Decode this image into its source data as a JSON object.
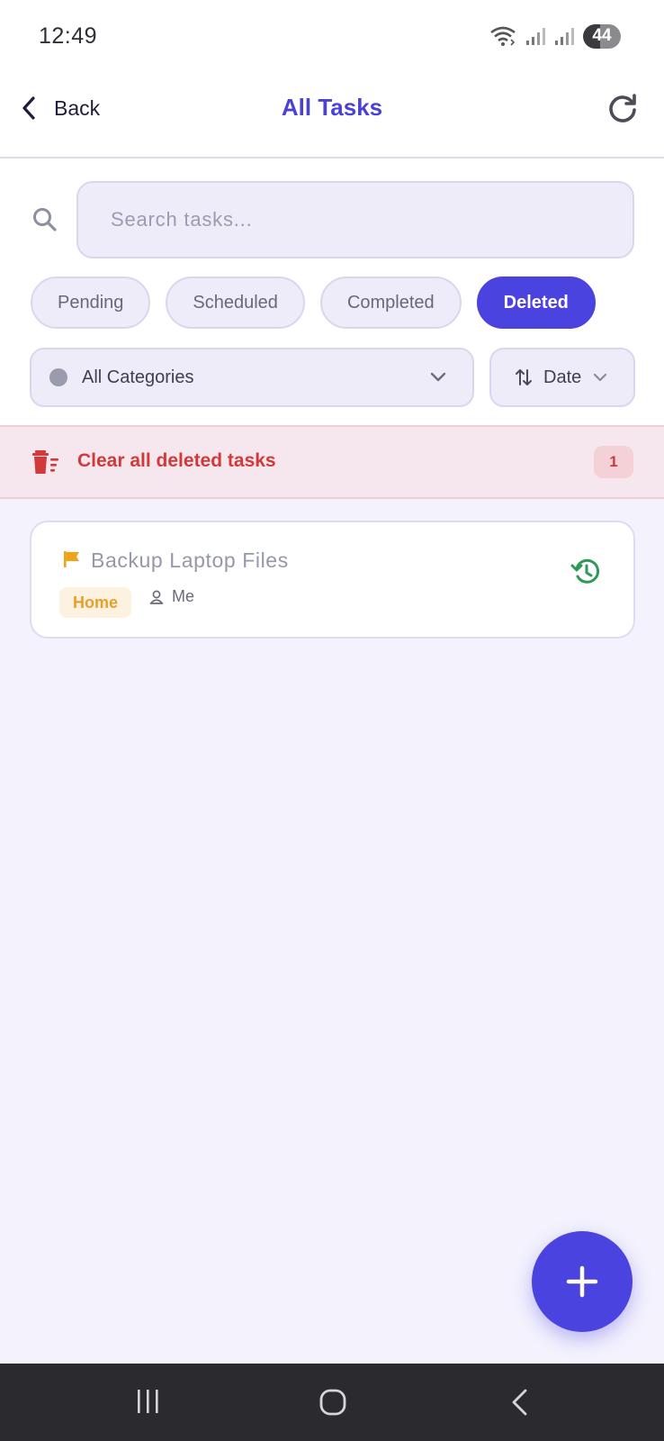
{
  "status_bar": {
    "time": "12:49",
    "battery": "44"
  },
  "header": {
    "back_label": "Back",
    "title": "All Tasks"
  },
  "search": {
    "placeholder": "Search tasks..."
  },
  "tabs": [
    {
      "label": "Pending",
      "active": false
    },
    {
      "label": "Scheduled",
      "active": false
    },
    {
      "label": "Completed",
      "active": false
    },
    {
      "label": "Deleted",
      "active": true
    }
  ],
  "category_filter": {
    "label": "All Categories"
  },
  "sort": {
    "label": "Date"
  },
  "clear_bar": {
    "label": "Clear all deleted tasks",
    "count": "1"
  },
  "tasks": [
    {
      "title": "Backup Laptop Files",
      "category": "Home",
      "assignee": "Me"
    }
  ],
  "colors": {
    "accent": "#4b43e0",
    "danger": "#d23a3a",
    "flag": "#f0a31a",
    "restore": "#2e9a55"
  }
}
